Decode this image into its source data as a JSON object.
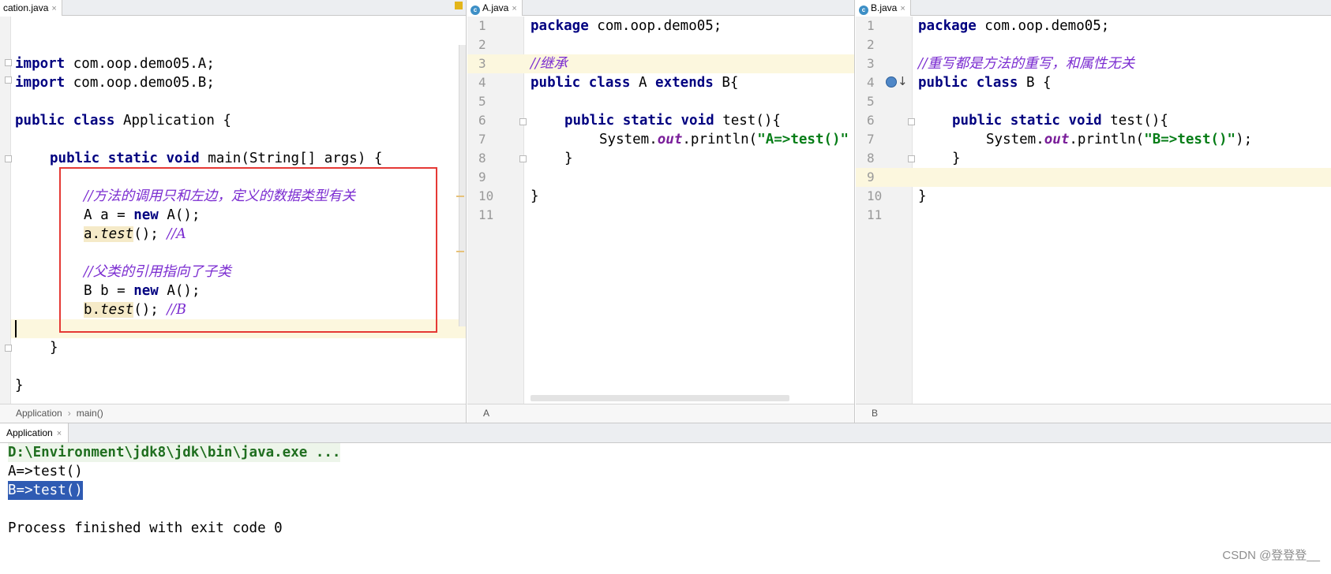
{
  "editor_tabs": {
    "application": "cation.java",
    "a": "A.java",
    "b": "B.java",
    "close_glyph": "×",
    "class_icon_letter": "c"
  },
  "application_code": {
    "import_a": [
      "import",
      " com.oop.demo05.A;"
    ],
    "import_b": [
      "import",
      " com.oop.demo05.B;"
    ],
    "class_decl": [
      "public class",
      " Application {"
    ],
    "main_decl": [
      "public static void",
      " main(String[] args) {"
    ],
    "comment1": "//方法的调用只和左边，定义的数据类型有关",
    "line_a_new": [
      "A a = ",
      "new",
      " A();"
    ],
    "line_a_test": [
      "a.",
      "test",
      "(); ",
      "//A"
    ],
    "comment2": "//父类的引用指向了子类",
    "line_b_new": [
      "B b = ",
      "new",
      " A();"
    ],
    "line_b_test": [
      "b.",
      "test",
      "(); ",
      "//B"
    ],
    "close_method": "}",
    "close_class": "}"
  },
  "a_code": {
    "line_numbers": [
      "1",
      "2",
      "3",
      "4",
      "5",
      "6",
      "7",
      "8",
      "9",
      "10",
      "11"
    ],
    "package": [
      "package",
      " com.oop.demo05;"
    ],
    "comment": "//继承",
    "class_decl": [
      "public class",
      " A ",
      "extends",
      " B{"
    ],
    "method_decl": [
      "public static void",
      " test(){"
    ],
    "println": [
      "System.",
      "out",
      ".println(",
      "\"A=>test()\""
    ],
    "close_method": "}",
    "close_class": "}"
  },
  "b_code": {
    "line_numbers": [
      "1",
      "2",
      "3",
      "4",
      "5",
      "6",
      "7",
      "8",
      "9",
      "10",
      "11"
    ],
    "package": [
      "package",
      " com.oop.demo05;"
    ],
    "comment": "//重写都是方法的重写，和属性无关",
    "class_decl": [
      "public class",
      " B {"
    ],
    "method_decl": [
      "public static void",
      " test(){"
    ],
    "println": [
      "System.",
      "out",
      ".println(",
      "\"B=>test()\"",
      ");"
    ],
    "close_method": "}",
    "close_class": "}"
  },
  "breadcrumbs": {
    "application": [
      "Application",
      "›",
      "main()"
    ],
    "a": "A",
    "b": "B"
  },
  "run": {
    "tab_label": "Application",
    "command": "D:\\Environment\\jdk8\\jdk\\bin\\java.exe ...",
    "output": [
      "A=>test()",
      "B=>test()"
    ],
    "exit": "Process finished with exit code 0"
  },
  "watermark": "CSDN @登登登__",
  "colors": {
    "keyword": "#000080",
    "comment": "#7a2bd0",
    "string": "#067d17",
    "highlight_box": "#e53935",
    "selection": "#2f5bb3"
  },
  "icons": [
    "class-icon",
    "override-gutter-icon",
    "fold-marker-icon",
    "check-icon",
    "close-icon"
  ]
}
